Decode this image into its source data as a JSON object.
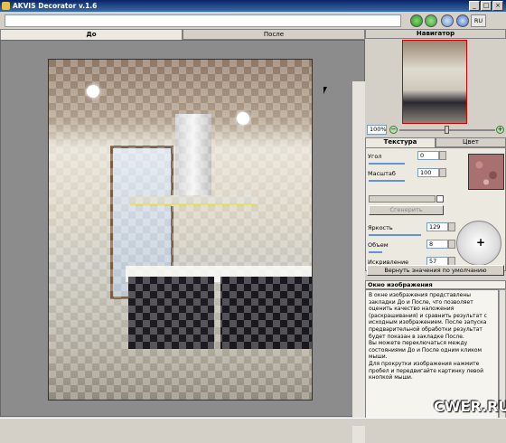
{
  "window": {
    "title": "AKVIS Decorator v.1.6",
    "minimize": "_",
    "maximize": "□",
    "close": "×"
  },
  "toolbar": {
    "language": "RU"
  },
  "tabs": [
    {
      "label": "До"
    },
    {
      "label": "После"
    }
  ],
  "navigator": {
    "title": "Навигатор",
    "zoom": "100%",
    "zoom_out": "−",
    "zoom_in": "+"
  },
  "subtabs": [
    {
      "label": "Текстура"
    },
    {
      "label": "Цвет"
    }
  ],
  "texture": {
    "angle_label": "Угол",
    "angle_value": "0",
    "scale_label": "Масштаб",
    "scale_value": "100",
    "sync_button": "Сгенерить",
    "brightness_label": "Яркость",
    "brightness_value": "129",
    "volume_label": "Объем",
    "volume_value": "8",
    "distortion_label": "Искривление",
    "distortion_value": "57",
    "reset_button": "Вернуть значения по умолчанию"
  },
  "info": {
    "title": "Окно изображения",
    "text1": "В окне изображения представлены закладки До и После, что позволяет оценить качество наложения (раскрашивания) и сравнить результат с исходным изображением. После запуска предварительной обработки результат будет показан в закладке После.",
    "text2": "Вы можете переключаться между состояниями До и После одним кликом мыши.",
    "text3": "Для прокрутки изображения нажмите пробел и передвигайте картинку левой кнопкой мыши."
  },
  "watermark": "CWER.RU",
  "colors": {
    "titlebar": "#0a246a",
    "accent_red": "#cc0000",
    "swatch": "#a87070"
  }
}
